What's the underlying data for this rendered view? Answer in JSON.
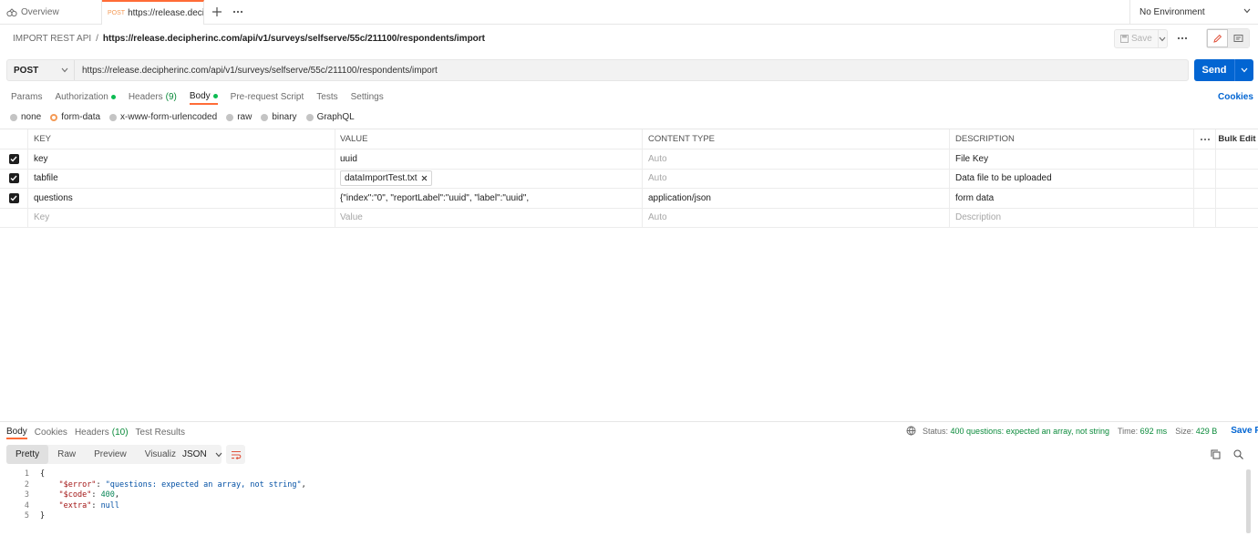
{
  "tabs": {
    "overview_label": "Overview",
    "active": {
      "method": "POST",
      "title": "https://release.decipher"
    }
  },
  "environment": {
    "label": "No Environment"
  },
  "breadcrumb": {
    "collection": "IMPORT REST API",
    "separator": "/",
    "request": "https://release.decipherinc.com/api/v1/surveys/selfserve/55c/211100/respondents/import"
  },
  "toolbar": {
    "save_label": "Save"
  },
  "request": {
    "method": "POST",
    "url": "https://release.decipherinc.com/api/v1/surveys/selfserve/55c/211100/respondents/import",
    "send_label": "Send"
  },
  "request_tabs": [
    {
      "label": "Params",
      "count": "",
      "dot": false,
      "active": false
    },
    {
      "label": "Authorization",
      "count": "",
      "dot": true,
      "active": false
    },
    {
      "label": "Headers",
      "count": "(9)",
      "dot": false,
      "active": false
    },
    {
      "label": "Body",
      "count": "",
      "dot": true,
      "active": true
    },
    {
      "label": "Pre-request Script",
      "count": "",
      "dot": false,
      "active": false
    },
    {
      "label": "Tests",
      "count": "",
      "dot": false,
      "active": false
    },
    {
      "label": "Settings",
      "count": "",
      "dot": false,
      "active": false
    }
  ],
  "cookies_label": "Cookies",
  "body_types": [
    {
      "label": "none",
      "selected": false
    },
    {
      "label": "form-data",
      "selected": true
    },
    {
      "label": "x-www-form-urlencoded",
      "selected": false
    },
    {
      "label": "raw",
      "selected": false
    },
    {
      "label": "binary",
      "selected": false
    },
    {
      "label": "GraphQL",
      "selected": false
    }
  ],
  "form_table": {
    "headers": {
      "key": "KEY",
      "value": "VALUE",
      "content_type": "CONTENT TYPE",
      "description": "DESCRIPTION",
      "bulk_edit": "Bulk Edit"
    },
    "rows": [
      {
        "checked": true,
        "key": "key",
        "value": "uuid",
        "value_is_file": false,
        "content_type": "Auto",
        "content_type_placeholder": true,
        "description": "File Key"
      },
      {
        "checked": true,
        "key": "tabfile",
        "value": "dataImportTest.txt",
        "value_is_file": true,
        "content_type": "Auto",
        "content_type_placeholder": true,
        "description": "Data file to be uploaded"
      },
      {
        "checked": true,
        "key": "questions",
        "value": "{\"index\":\"0\", \"reportLabel\":\"uuid\", \"label\":\"uuid\",",
        "value_is_file": false,
        "content_type": "application/json",
        "content_type_placeholder": false,
        "description": "form data"
      }
    ],
    "placeholder_row": {
      "key": "Key",
      "value": "Value",
      "content_type": "Auto",
      "description": "Description"
    }
  },
  "response": {
    "tabs": [
      {
        "label": "Body",
        "count": "",
        "active": true
      },
      {
        "label": "Cookies",
        "count": "",
        "active": false
      },
      {
        "label": "Headers",
        "count": "(10)",
        "active": false
      },
      {
        "label": "Test Results",
        "count": "",
        "active": false
      }
    ],
    "status_label": "Status:",
    "status_value": "400 questions: expected an array, not string",
    "time_label": "Time:",
    "time_value": "692 ms",
    "size_label": "Size:",
    "size_value": "429 B",
    "save_response_label": "Save Response",
    "view_modes": [
      "Pretty",
      "Raw",
      "Preview",
      "Visualize"
    ],
    "active_view": "Pretty",
    "format": "JSON",
    "code_lines": [
      {
        "n": "1",
        "open": "{",
        "key": "",
        "val": "",
        "valType": "",
        "comma": ""
      },
      {
        "n": "2",
        "open": "",
        "key": "\"$error\"",
        "val": "\"questions: expected an array, not string\"",
        "valType": "str",
        "comma": ","
      },
      {
        "n": "3",
        "open": "",
        "key": "\"$code\"",
        "val": "400",
        "valType": "num",
        "comma": ","
      },
      {
        "n": "4",
        "open": "",
        "key": "\"extra\"",
        "val": "null",
        "valType": "kw",
        "comma": ""
      },
      {
        "n": "5",
        "open": "}",
        "key": "",
        "val": "",
        "valType": "",
        "comma": ""
      }
    ]
  },
  "colors": {
    "accent": "#ff6c37",
    "send": "#0265d2",
    "ok_green": "#0cbb52",
    "status_green": "#0a8a3a"
  }
}
